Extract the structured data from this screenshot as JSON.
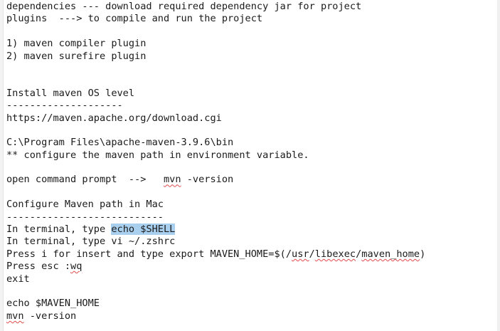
{
  "editor": {
    "lines": [
      {
        "text": "dependencies --- download required dependency jar for project"
      },
      {
        "text": "plugins  ---> to compile and run the project"
      },
      {
        "text": ""
      },
      {
        "text": "1) maven compiler plugin"
      },
      {
        "text": "2) maven surefire plugin"
      },
      {
        "text": ""
      },
      {
        "text": ""
      },
      {
        "text": "Install maven OS level"
      },
      {
        "text": "--------------------"
      },
      {
        "text": "https://maven.apache.org/download.cgi"
      },
      {
        "text": ""
      },
      {
        "text": "C:\\Program Files\\apache-maven-3.9.6\\bin"
      },
      {
        "text": "** configure the maven path in environment variable."
      },
      {
        "text": ""
      },
      {
        "pre": "open command prompt  -->   ",
        "sq": "mvn",
        "post": " -version"
      },
      {
        "text": ""
      },
      {
        "text": "Configure Maven path in Mac"
      },
      {
        "text": "---------------------------"
      },
      {
        "pre": "In terminal, type ",
        "hl": "echo $SHELL"
      },
      {
        "text": "In terminal, type vi ~/.zshrc"
      },
      {
        "pre": "Press i for insert and type export MAVEN_HOME=$(/",
        "sq": "usr",
        "mid": "/",
        "sq2": "libexec",
        "mid2": "/",
        "sq3": "maven_home",
        "post": ")"
      },
      {
        "pre": "Press esc :",
        "sq": "wq"
      },
      {
        "text": "exit"
      },
      {
        "text": ""
      },
      {
        "text": "echo $MAVEN_HOME"
      },
      {
        "sq": "mvn",
        "post": " -version"
      }
    ]
  }
}
